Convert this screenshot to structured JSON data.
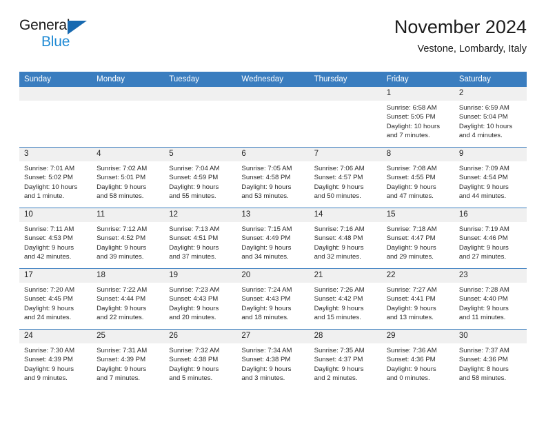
{
  "brand": {
    "name_part1": "General",
    "name_part2": "Blue",
    "triangle_color": "#1769b0",
    "blue_color": "#1f8ad4"
  },
  "header": {
    "title": "November 2024",
    "subtitle": "Vestone, Lombardy, Italy"
  },
  "theme": {
    "header_blue": "#3a7dbf",
    "daynum_gray": "#f0f0f0"
  },
  "weekday_headers": [
    "Sunday",
    "Monday",
    "Tuesday",
    "Wednesday",
    "Thursday",
    "Friday",
    "Saturday"
  ],
  "labels": {
    "sunrise_prefix": "Sunrise:",
    "sunset_prefix": "Sunset:",
    "daylight_prefix": "Daylight:"
  },
  "weeks": [
    [
      {
        "day": "",
        "empty": true
      },
      {
        "day": "",
        "empty": true
      },
      {
        "day": "",
        "empty": true
      },
      {
        "day": "",
        "empty": true
      },
      {
        "day": "",
        "empty": true
      },
      {
        "day": "1",
        "sunrise": "Sunrise: 6:58 AM",
        "sunset": "Sunset: 5:05 PM",
        "daylight_line1": "Daylight: 10 hours",
        "daylight_line2": "and 7 minutes."
      },
      {
        "day": "2",
        "sunrise": "Sunrise: 6:59 AM",
        "sunset": "Sunset: 5:04 PM",
        "daylight_line1": "Daylight: 10 hours",
        "daylight_line2": "and 4 minutes."
      }
    ],
    [
      {
        "day": "3",
        "sunrise": "Sunrise: 7:01 AM",
        "sunset": "Sunset: 5:02 PM",
        "daylight_line1": "Daylight: 10 hours",
        "daylight_line2": "and 1 minute."
      },
      {
        "day": "4",
        "sunrise": "Sunrise: 7:02 AM",
        "sunset": "Sunset: 5:01 PM",
        "daylight_line1": "Daylight: 9 hours",
        "daylight_line2": "and 58 minutes."
      },
      {
        "day": "5",
        "sunrise": "Sunrise: 7:04 AM",
        "sunset": "Sunset: 4:59 PM",
        "daylight_line1": "Daylight: 9 hours",
        "daylight_line2": "and 55 minutes."
      },
      {
        "day": "6",
        "sunrise": "Sunrise: 7:05 AM",
        "sunset": "Sunset: 4:58 PM",
        "daylight_line1": "Daylight: 9 hours",
        "daylight_line2": "and 53 minutes."
      },
      {
        "day": "7",
        "sunrise": "Sunrise: 7:06 AM",
        "sunset": "Sunset: 4:57 PM",
        "daylight_line1": "Daylight: 9 hours",
        "daylight_line2": "and 50 minutes."
      },
      {
        "day": "8",
        "sunrise": "Sunrise: 7:08 AM",
        "sunset": "Sunset: 4:55 PM",
        "daylight_line1": "Daylight: 9 hours",
        "daylight_line2": "and 47 minutes."
      },
      {
        "day": "9",
        "sunrise": "Sunrise: 7:09 AM",
        "sunset": "Sunset: 4:54 PM",
        "daylight_line1": "Daylight: 9 hours",
        "daylight_line2": "and 44 minutes."
      }
    ],
    [
      {
        "day": "10",
        "sunrise": "Sunrise: 7:11 AM",
        "sunset": "Sunset: 4:53 PM",
        "daylight_line1": "Daylight: 9 hours",
        "daylight_line2": "and 42 minutes."
      },
      {
        "day": "11",
        "sunrise": "Sunrise: 7:12 AM",
        "sunset": "Sunset: 4:52 PM",
        "daylight_line1": "Daylight: 9 hours",
        "daylight_line2": "and 39 minutes."
      },
      {
        "day": "12",
        "sunrise": "Sunrise: 7:13 AM",
        "sunset": "Sunset: 4:51 PM",
        "daylight_line1": "Daylight: 9 hours",
        "daylight_line2": "and 37 minutes."
      },
      {
        "day": "13",
        "sunrise": "Sunrise: 7:15 AM",
        "sunset": "Sunset: 4:49 PM",
        "daylight_line1": "Daylight: 9 hours",
        "daylight_line2": "and 34 minutes."
      },
      {
        "day": "14",
        "sunrise": "Sunrise: 7:16 AM",
        "sunset": "Sunset: 4:48 PM",
        "daylight_line1": "Daylight: 9 hours",
        "daylight_line2": "and 32 minutes."
      },
      {
        "day": "15",
        "sunrise": "Sunrise: 7:18 AM",
        "sunset": "Sunset: 4:47 PM",
        "daylight_line1": "Daylight: 9 hours",
        "daylight_line2": "and 29 minutes."
      },
      {
        "day": "16",
        "sunrise": "Sunrise: 7:19 AM",
        "sunset": "Sunset: 4:46 PM",
        "daylight_line1": "Daylight: 9 hours",
        "daylight_line2": "and 27 minutes."
      }
    ],
    [
      {
        "day": "17",
        "sunrise": "Sunrise: 7:20 AM",
        "sunset": "Sunset: 4:45 PM",
        "daylight_line1": "Daylight: 9 hours",
        "daylight_line2": "and 24 minutes."
      },
      {
        "day": "18",
        "sunrise": "Sunrise: 7:22 AM",
        "sunset": "Sunset: 4:44 PM",
        "daylight_line1": "Daylight: 9 hours",
        "daylight_line2": "and 22 minutes."
      },
      {
        "day": "19",
        "sunrise": "Sunrise: 7:23 AM",
        "sunset": "Sunset: 4:43 PM",
        "daylight_line1": "Daylight: 9 hours",
        "daylight_line2": "and 20 minutes."
      },
      {
        "day": "20",
        "sunrise": "Sunrise: 7:24 AM",
        "sunset": "Sunset: 4:43 PM",
        "daylight_line1": "Daylight: 9 hours",
        "daylight_line2": "and 18 minutes."
      },
      {
        "day": "21",
        "sunrise": "Sunrise: 7:26 AM",
        "sunset": "Sunset: 4:42 PM",
        "daylight_line1": "Daylight: 9 hours",
        "daylight_line2": "and 15 minutes."
      },
      {
        "day": "22",
        "sunrise": "Sunrise: 7:27 AM",
        "sunset": "Sunset: 4:41 PM",
        "daylight_line1": "Daylight: 9 hours",
        "daylight_line2": "and 13 minutes."
      },
      {
        "day": "23",
        "sunrise": "Sunrise: 7:28 AM",
        "sunset": "Sunset: 4:40 PM",
        "daylight_line1": "Daylight: 9 hours",
        "daylight_line2": "and 11 minutes."
      }
    ],
    [
      {
        "day": "24",
        "sunrise": "Sunrise: 7:30 AM",
        "sunset": "Sunset: 4:39 PM",
        "daylight_line1": "Daylight: 9 hours",
        "daylight_line2": "and 9 minutes."
      },
      {
        "day": "25",
        "sunrise": "Sunrise: 7:31 AM",
        "sunset": "Sunset: 4:39 PM",
        "daylight_line1": "Daylight: 9 hours",
        "daylight_line2": "and 7 minutes."
      },
      {
        "day": "26",
        "sunrise": "Sunrise: 7:32 AM",
        "sunset": "Sunset: 4:38 PM",
        "daylight_line1": "Daylight: 9 hours",
        "daylight_line2": "and 5 minutes."
      },
      {
        "day": "27",
        "sunrise": "Sunrise: 7:34 AM",
        "sunset": "Sunset: 4:38 PM",
        "daylight_line1": "Daylight: 9 hours",
        "daylight_line2": "and 3 minutes."
      },
      {
        "day": "28",
        "sunrise": "Sunrise: 7:35 AM",
        "sunset": "Sunset: 4:37 PM",
        "daylight_line1": "Daylight: 9 hours",
        "daylight_line2": "and 2 minutes."
      },
      {
        "day": "29",
        "sunrise": "Sunrise: 7:36 AM",
        "sunset": "Sunset: 4:36 PM",
        "daylight_line1": "Daylight: 9 hours",
        "daylight_line2": "and 0 minutes."
      },
      {
        "day": "30",
        "sunrise": "Sunrise: 7:37 AM",
        "sunset": "Sunset: 4:36 PM",
        "daylight_line1": "Daylight: 8 hours",
        "daylight_line2": "and 58 minutes."
      }
    ]
  ]
}
